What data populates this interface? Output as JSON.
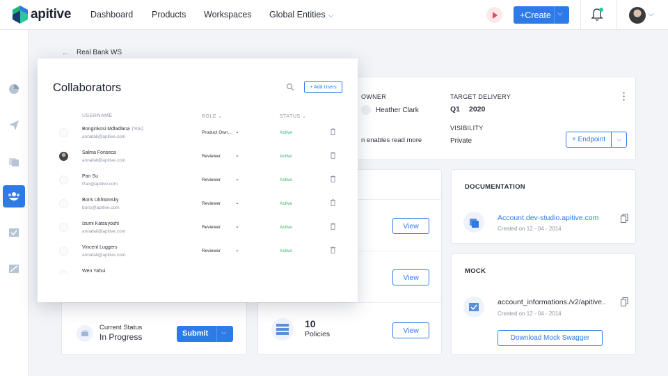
{
  "nav": {
    "logo_text": "apitive",
    "links": [
      "Dashboard",
      "Products",
      "Workspaces",
      "Global Entities"
    ],
    "create_label": "+Create"
  },
  "breadcrumb": "Real Bank WS",
  "overview": {
    "owner_label": "OWNER",
    "owner_name": "Heather Clark",
    "target_label": "TARGET DELIVERY",
    "target_quarter": "Q1",
    "target_year": "2020",
    "visibility_label": "VISIBILITY",
    "visibility_value": "Private",
    "description_tail": "n enables",
    "read_more": "read more",
    "endpoint_label": "+ Endpoint"
  },
  "status_card": {
    "label": "Current Status",
    "value": "In Progress",
    "submit_label": "Submit"
  },
  "middle_card": {
    "view_label": "View",
    "policies_count": "10",
    "policies_label": "Policies"
  },
  "documentation": {
    "title": "DOCUMENTATION",
    "link": "Account.dev-studio.apitive.com",
    "created": "Created on   12 - 04 - 2014"
  },
  "mock": {
    "title": "MOCK",
    "link": "account_informations./v2/apitive..",
    "created": "Created on   12 - 04 - 2014",
    "download_label": "Download Mock Swagger"
  },
  "collaborators": {
    "title": "Collaborators",
    "add_users": "+ Add Users",
    "headers": {
      "username": "USERNAME",
      "role": "ROLE",
      "status": "STATUS"
    },
    "rows": [
      {
        "name": "Bonginkosi Mdladlana",
        "you": "(You)",
        "email": "annafali@apitive.com",
        "role": "Product Own...",
        "status": "Active"
      },
      {
        "name": "Salma Fonseca",
        "you": "",
        "email": "annafali@apitive.com",
        "role": "Reviewer",
        "status": "Active"
      },
      {
        "name": "Pan Su",
        "you": "",
        "email": "Pan@apitive.com",
        "role": "Reviewer",
        "status": "Active"
      },
      {
        "name": "Boris Ukhtomsky",
        "you": "",
        "email": "boris@apitive.com",
        "role": "Reviewer",
        "status": "Active"
      },
      {
        "name": "Izumi Katsuyoshi",
        "you": "",
        "email": "annafali@apitive.com",
        "role": "Reviewer",
        "status": "Active"
      },
      {
        "name": "Vincent Luggers",
        "you": "",
        "email": "annafali@apitive.com",
        "role": "Reviewer",
        "status": "Active"
      },
      {
        "name": "Wen Yahui",
        "you": "",
        "email": "",
        "role": "",
        "status": ""
      }
    ]
  }
}
